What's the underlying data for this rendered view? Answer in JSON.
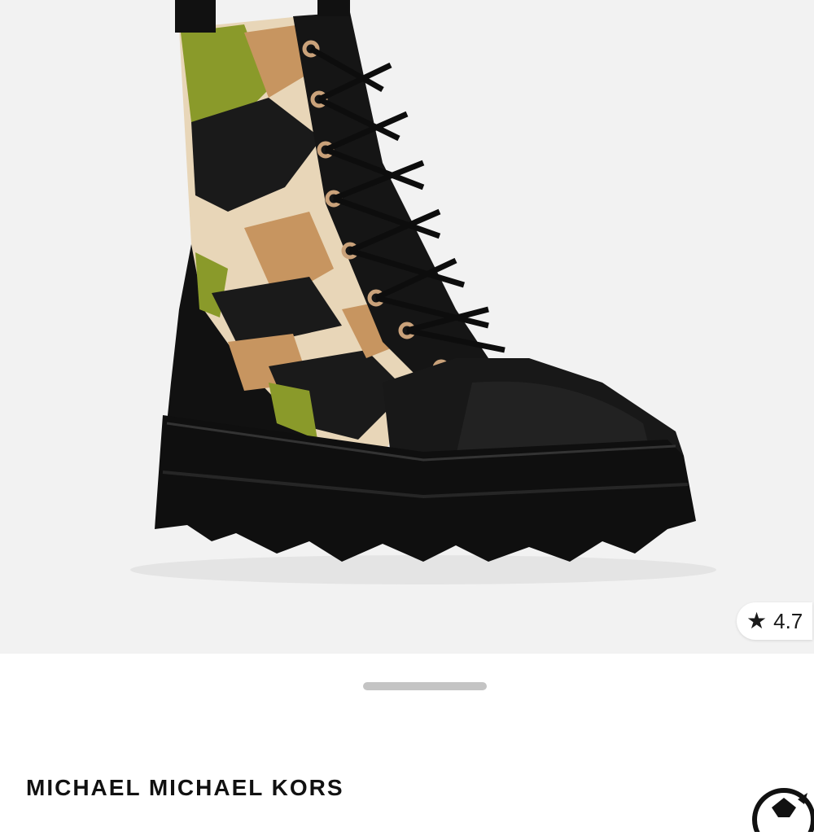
{
  "product": {
    "image_alt": "camo calf hair combat boot",
    "rating": "4.7",
    "brand": "MICHAEL MICHAEL KORS"
  },
  "icons": {
    "rating": "star-icon",
    "corner": "brand-logo-icon"
  },
  "colors": {
    "background": "#ffffff",
    "image_bg": "#f2f2f2",
    "text": "#111111",
    "handle": "#c4c4c4"
  }
}
